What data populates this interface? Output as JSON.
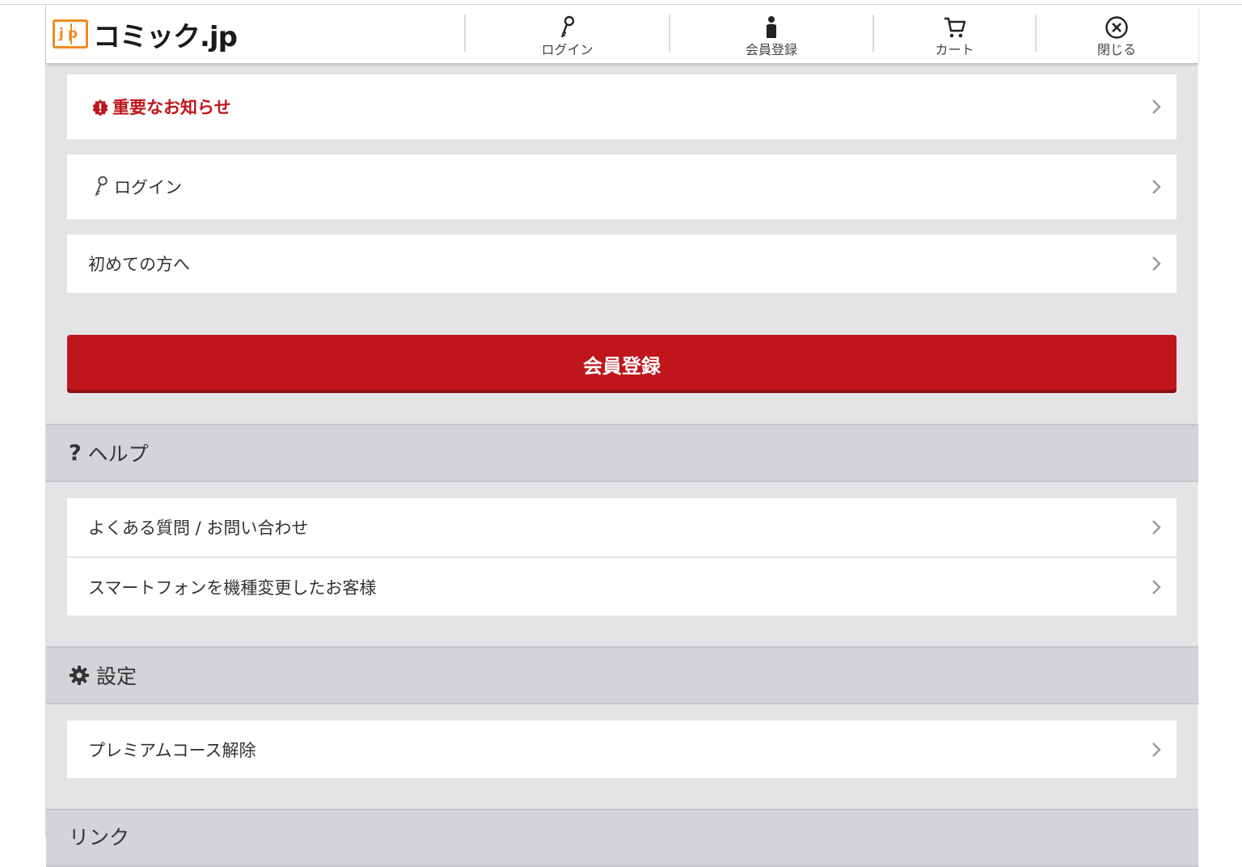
{
  "header": {
    "logo_mark": "jp",
    "logo_text": "コミック.jp",
    "nav": [
      {
        "label": "ログイン",
        "icon": "key-icon"
      },
      {
        "label": "会員登録",
        "icon": "person-icon"
      },
      {
        "label": "カート",
        "icon": "cart-icon"
      },
      {
        "label": "閉じる",
        "icon": "close-circle-icon"
      }
    ]
  },
  "menu": {
    "important_notice": "重要なお知らせ",
    "login": "ログイン",
    "first_time": "初めての方へ",
    "register_button": "会員登録"
  },
  "help": {
    "title": "ヘルプ",
    "items": [
      "よくある質問 / お問い合わせ",
      "スマートフォンを機種変更したお客様"
    ]
  },
  "settings": {
    "title": "設定",
    "items": [
      "プレミアムコース解除"
    ]
  },
  "links": {
    "title": "リンク"
  },
  "colors": {
    "accent_red": "#bf161c",
    "logo_orange": "#f08a24",
    "background": "#e4e4e6"
  }
}
